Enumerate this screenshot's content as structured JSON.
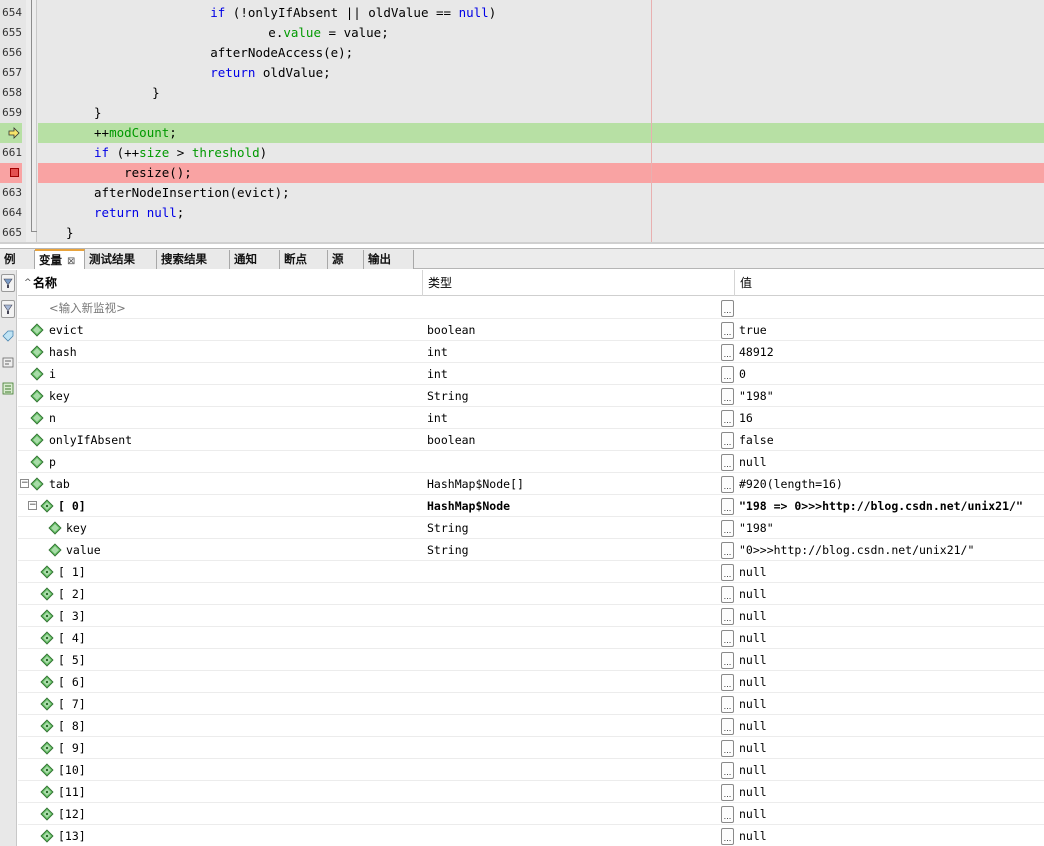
{
  "editor": {
    "lines": [
      {
        "num": "654",
        "state": "normal",
        "parts": [
          [
            "        ",
            ""
          ],
          [
            "if",
            "kw"
          ],
          [
            " (!onlyIfAbsent || oldValue == ",
            ""
          ],
          [
            "null",
            "kw"
          ],
          [
            ")",
            ""
          ]
        ]
      },
      {
        "num": "655",
        "state": "normal",
        "parts": [
          [
            "            e.",
            ""
          ],
          [
            "value",
            "fld"
          ],
          [
            " = value;",
            ""
          ]
        ]
      },
      {
        "num": "656",
        "state": "normal",
        "parts": [
          [
            "        afterNodeAccess(e);",
            ""
          ]
        ]
      },
      {
        "num": "657",
        "state": "normal",
        "parts": [
          [
            "        ",
            ""
          ],
          [
            "return",
            "kw"
          ],
          [
            " oldValue;",
            ""
          ]
        ]
      },
      {
        "num": "658",
        "state": "normal",
        "parts": [
          [
            "    }",
            ""
          ]
        ]
      },
      {
        "num": "659",
        "state": "normal",
        "parts": [
          [
            "}",
            ""
          ]
        ]
      },
      {
        "num": "",
        "state": "current",
        "parts": [
          [
            "++",
            ""
          ],
          [
            "modCount",
            "fld"
          ],
          [
            ";",
            ""
          ]
        ]
      },
      {
        "num": "661",
        "state": "normal",
        "parts": [
          [
            "",
            ""
          ],
          [
            "if",
            "kw"
          ],
          [
            " (++",
            ""
          ],
          [
            "size",
            "fld"
          ],
          [
            " > ",
            ""
          ],
          [
            "threshold",
            "fld"
          ],
          [
            ")",
            ""
          ]
        ]
      },
      {
        "num": "",
        "state": "breakpoint",
        "parts": [
          [
            "    resize();",
            ""
          ]
        ]
      },
      {
        "num": "663",
        "state": "normal",
        "parts": [
          [
            "afterNodeInsertion(evict);",
            ""
          ]
        ]
      },
      {
        "num": "664",
        "state": "normal",
        "parts": [
          [
            "",
            ""
          ],
          [
            "return",
            "kw"
          ],
          [
            " ",
            ""
          ],
          [
            "null",
            "kw"
          ],
          [
            ";",
            ""
          ]
        ]
      },
      {
        "num": "665",
        "state": "normal",
        "parts": [
          [
            "}",
            ""
          ]
        ]
      }
    ]
  },
  "tabs": [
    {
      "label": "例",
      "active": false,
      "closable": false
    },
    {
      "label": "变量",
      "active": true,
      "closable": true
    },
    {
      "label": "测试结果",
      "active": false,
      "closable": false
    },
    {
      "label": "搜索结果",
      "active": false,
      "closable": false
    },
    {
      "label": "通知",
      "active": false,
      "closable": false
    },
    {
      "label": "断点",
      "active": false,
      "closable": false
    },
    {
      "label": "源",
      "active": false,
      "closable": false
    },
    {
      "label": "输出",
      "active": false,
      "closable": false
    }
  ],
  "tab_close_glyph": "⊠",
  "table": {
    "headers": {
      "name": "名称",
      "type": "类型",
      "value": "值"
    },
    "sort_glyph": "^",
    "placeholder": "<输入新监视>",
    "edit_glyph": "...",
    "rows": [
      {
        "name": "evict",
        "type": "boolean",
        "value": "true",
        "level": 0,
        "toggle": "",
        "bold": false
      },
      {
        "name": "hash",
        "type": "int",
        "value": "48912",
        "level": 0,
        "toggle": "",
        "bold": false
      },
      {
        "name": "i",
        "type": "int",
        "value": "0",
        "level": 0,
        "toggle": "",
        "bold": false
      },
      {
        "name": "key",
        "type": "String",
        "value": "\"198\"",
        "level": 0,
        "toggle": "",
        "bold": false
      },
      {
        "name": "n",
        "type": "int",
        "value": "16",
        "level": 0,
        "toggle": "",
        "bold": false
      },
      {
        "name": "onlyIfAbsent",
        "type": "boolean",
        "value": "false",
        "level": 0,
        "toggle": "",
        "bold": false
      },
      {
        "name": "p",
        "type": "",
        "value": "null",
        "level": 0,
        "toggle": "",
        "bold": false
      },
      {
        "name": "tab",
        "type": "HashMap$Node[]",
        "value": "#920(length=16)",
        "level": 0,
        "toggle": "−",
        "bold": false
      },
      {
        "name": "[ 0]",
        "type": "HashMap$Node",
        "value": "\"198 => 0>>>http://blog.csdn.net/unix21/\"",
        "level": 1,
        "toggle": "−",
        "bold": true
      },
      {
        "name": "key",
        "type": "String",
        "value": "\"198\"",
        "level": 2,
        "toggle": "",
        "bold": false
      },
      {
        "name": "value",
        "type": "String",
        "value": "\"0>>>http://blog.csdn.net/unix21/\"",
        "level": 2,
        "toggle": "",
        "bold": false
      },
      {
        "name": "[ 1]",
        "type": "",
        "value": "null",
        "level": 1,
        "toggle": "",
        "bold": false
      },
      {
        "name": "[ 2]",
        "type": "",
        "value": "null",
        "level": 1,
        "toggle": "",
        "bold": false
      },
      {
        "name": "[ 3]",
        "type": "",
        "value": "null",
        "level": 1,
        "toggle": "",
        "bold": false
      },
      {
        "name": "[ 4]",
        "type": "",
        "value": "null",
        "level": 1,
        "toggle": "",
        "bold": false
      },
      {
        "name": "[ 5]",
        "type": "",
        "value": "null",
        "level": 1,
        "toggle": "",
        "bold": false
      },
      {
        "name": "[ 6]",
        "type": "",
        "value": "null",
        "level": 1,
        "toggle": "",
        "bold": false
      },
      {
        "name": "[ 7]",
        "type": "",
        "value": "null",
        "level": 1,
        "toggle": "",
        "bold": false
      },
      {
        "name": "[ 8]",
        "type": "",
        "value": "null",
        "level": 1,
        "toggle": "",
        "bold": false
      },
      {
        "name": "[ 9]",
        "type": "",
        "value": "null",
        "level": 1,
        "toggle": "",
        "bold": false
      },
      {
        "name": "[10]",
        "type": "",
        "value": "null",
        "level": 1,
        "toggle": "",
        "bold": false
      },
      {
        "name": "[11]",
        "type": "",
        "value": "null",
        "level": 1,
        "toggle": "",
        "bold": false
      },
      {
        "name": "[12]",
        "type": "",
        "value": "null",
        "level": 1,
        "toggle": "",
        "bold": false
      },
      {
        "name": "[13]",
        "type": "",
        "value": "null",
        "level": 1,
        "toggle": "",
        "bold": false
      }
    ]
  },
  "colors": {
    "current_line": "#b7e0a4",
    "breakpoint_line": "#f9a3a3",
    "keyword": "#0000e6",
    "field": "#009900",
    "active_tab_accent": "#e8a33c",
    "variable_icon": "#5cb85c"
  },
  "icons": {
    "current_line": "program-counter-arrow-icon",
    "breakpoint": "breakpoint-icon",
    "variable": "variable-diamond-icon",
    "field": "field-diamond-icon"
  }
}
